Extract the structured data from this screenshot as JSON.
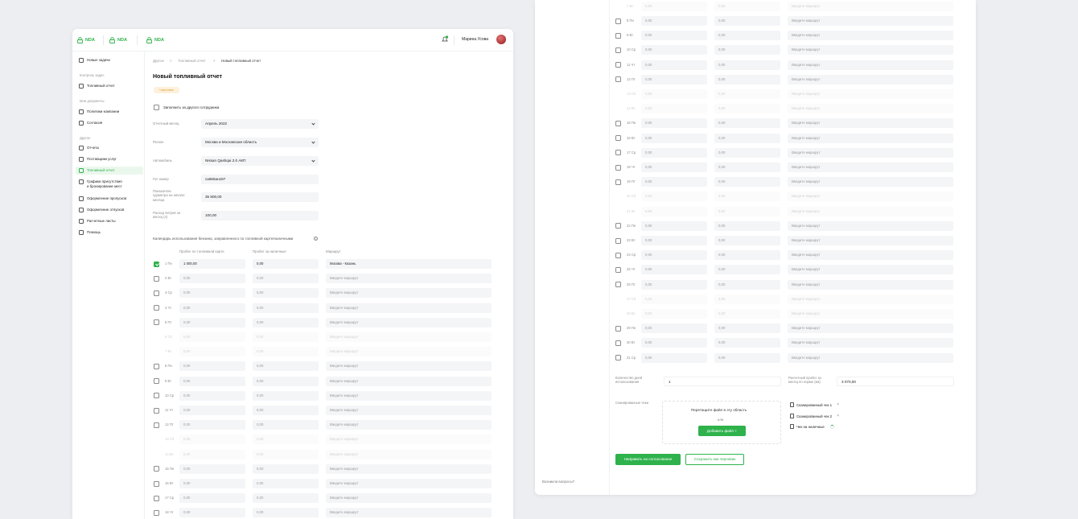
{
  "topbar": {
    "tabs": [
      "NDA",
      "NDA",
      "NDA"
    ],
    "user_name": "Марина Усова",
    "notification_count": ""
  },
  "sidebar": {
    "new_tasks": "Новые задачи",
    "group_control": "Контроль задач",
    "fuel_report_top": "Топливный отчет",
    "group_docs": "Мои документы",
    "company_policy": "Политики компании",
    "approvals": "Согласия",
    "group_other": "Другое",
    "reports": "Отчеты",
    "suppliers": "Поставщики услуг",
    "fuel_report": "Топливный отчет",
    "schedules_line1": "Графики присутствия",
    "schedules_line2": "и бронирование мест",
    "passes": "Оформление пропусков",
    "vacations": "Оформление отпусков",
    "payslips": "Расчетные листы",
    "help": "Помощь",
    "questions": "Возникли вопросы?"
  },
  "breadcrumb": {
    "item1": "Другое",
    "sep": ">",
    "item2": "Топливный отчет",
    "item3": "Новый топливный отчет"
  },
  "page": {
    "title": "Новый топливный отчет",
    "status_badge": "Черновик",
    "fill_for_other": "Заполнить за другого сотрудника"
  },
  "form": {
    "month_label": "Отчетный месяц",
    "month_value": "Апрель 2022",
    "region_label": "Регион",
    "region_value": "Москва и Московская область",
    "car_label": "Автомобиль",
    "car_value": "Nissan Qashqai 2.0 АКП",
    "plate_label": "Гос номер",
    "plate_value": "са655ан197",
    "odometer_label_1": "Показатели",
    "odometer_label_2": "одометра на начало",
    "odometer_label_3": "месяца",
    "odometer_value": "35 800,00",
    "consumption_label_1": "Расход литров за",
    "consumption_label_2": "месяц (л)",
    "consumption_value": "100,00"
  },
  "calendar": {
    "caption": "Календарь использования бензина, заправленного по топливной карте/наличными",
    "col_card": "Пробег по топливной карте",
    "col_cash": "Пробег за наличные",
    "col_route": "Маршрут",
    "route_placeholder": "Введите маршрут",
    "zero": "0,00",
    "first_day_card": "1 000,00",
    "first_day_route": "Москва - Казань",
    "days": [
      "1 Пн",
      "2 Вт",
      "3 Ср",
      "4 Чт",
      "5 Пт",
      "6 Сб",
      "7 Вс",
      "8 Пн",
      "9 Вт",
      "10 Ср",
      "11 Чт",
      "12 Пт",
      "13 Сб",
      "14 Вс",
      "15 Пн",
      "16 Вт",
      "17 Ср",
      "18 Чт",
      "19 Пт",
      "20 Сб",
      "21 Вс",
      "22 Пн",
      "23 Вт",
      "24 Ср",
      "25 Чт",
      "26 Пт",
      "27 Сб",
      "28 Вс",
      "29 Пн",
      "30 Вт",
      "31 Ср"
    ]
  },
  "summary": {
    "days_used_label_1": "Количество дней",
    "days_used_label_2": "использования",
    "days_used_value": "1",
    "calc_label_1": "Расчетный пробег за",
    "calc_label_2": "месяц по норме (км)",
    "calc_value": "3 070,00"
  },
  "upload": {
    "label": "Сканированные чеки",
    "drop_text": "Перетащите файл в эту область",
    "or": "или",
    "add_button": "Добавить файл",
    "add_icon": "+",
    "files": [
      "Сканированный чек 1",
      "Сканированный чек 2",
      "Чек на наличные"
    ]
  },
  "actions": {
    "submit": "Направить на согласование",
    "save_draft": "Сохранить как черновик"
  },
  "colors": {
    "accent": "#2fb24c",
    "badge_bg": "#fdf1dc",
    "badge_text": "#e3a03a"
  }
}
